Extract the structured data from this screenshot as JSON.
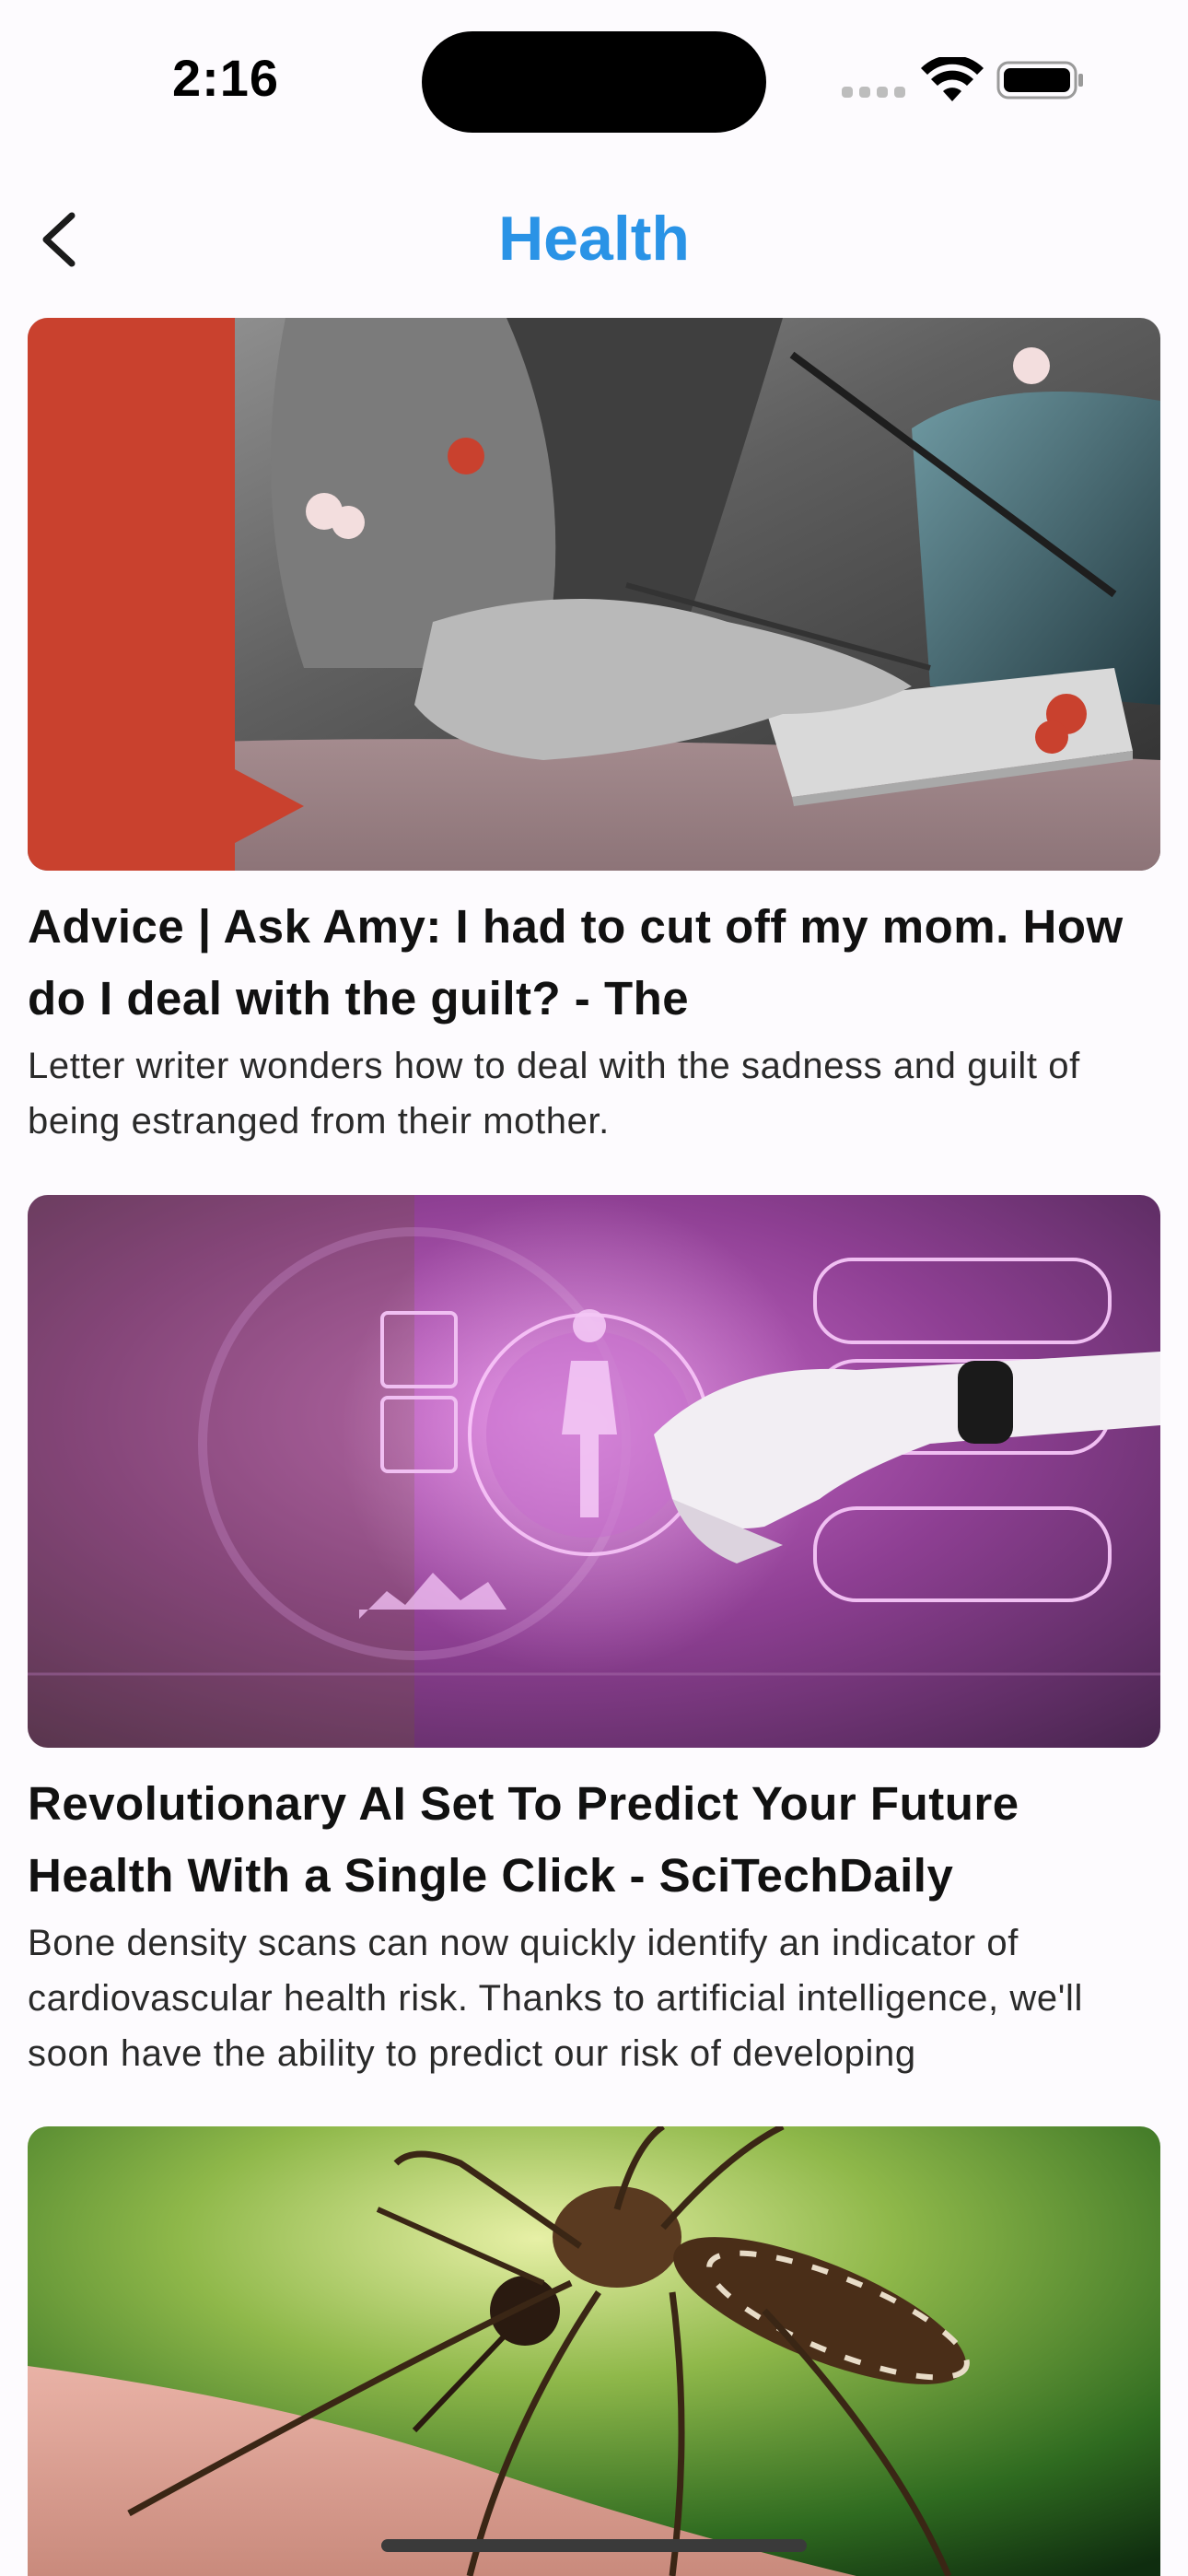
{
  "status_bar": {
    "time": "2:16",
    "icons": [
      "signal-icon",
      "wifi-icon",
      "battery-icon"
    ]
  },
  "nav": {
    "back_icon": "chevron-left-icon",
    "title": "Health",
    "title_color": "#2A93E6"
  },
  "articles": [
    {
      "title": "Advice | Ask Amy: I had to cut off my mom. How do I deal with the guilt? - The",
      "description": "Letter writer wonders how to deal with the sadness and guilt of being estranged from their mother."
    },
    {
      "title": "Revolutionary AI Set To Predict Your Future Health With a Single Click - SciTechDaily",
      "description": "Bone density scans can now quickly identify an indicator of cardiovascular health risk. Thanks to artificial intelligence, we'll soon have the ability to predict our risk of developing"
    },
    {
      "title": "",
      "description": ""
    }
  ],
  "colors": {
    "background": "#FDFBFE",
    "accent": "#2A93E6"
  }
}
